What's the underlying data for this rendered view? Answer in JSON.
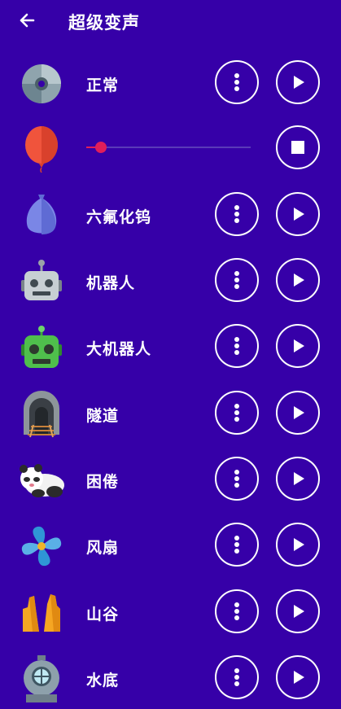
{
  "header": {
    "title": "超级变声"
  },
  "effects": [
    {
      "label": "正常",
      "icon": "disc-icon"
    },
    {
      "label": "",
      "icon": "balloon-icon",
      "state": "playing",
      "progress": 0.09
    },
    {
      "label": "六氟化钨",
      "icon": "blue-balloon-icon"
    },
    {
      "label": "机器人",
      "icon": "robot-icon"
    },
    {
      "label": "大机器人",
      "icon": "green-robot-icon"
    },
    {
      "label": "隧道",
      "icon": "tunnel-icon"
    },
    {
      "label": "困倦",
      "icon": "panda-icon"
    },
    {
      "label": "风扇",
      "icon": "fan-icon"
    },
    {
      "label": "山谷",
      "icon": "canyon-icon"
    },
    {
      "label": "水底",
      "icon": "diving-helmet-icon"
    }
  ],
  "colors": {
    "background": "#3600a8",
    "accent": "#e01e5a"
  }
}
